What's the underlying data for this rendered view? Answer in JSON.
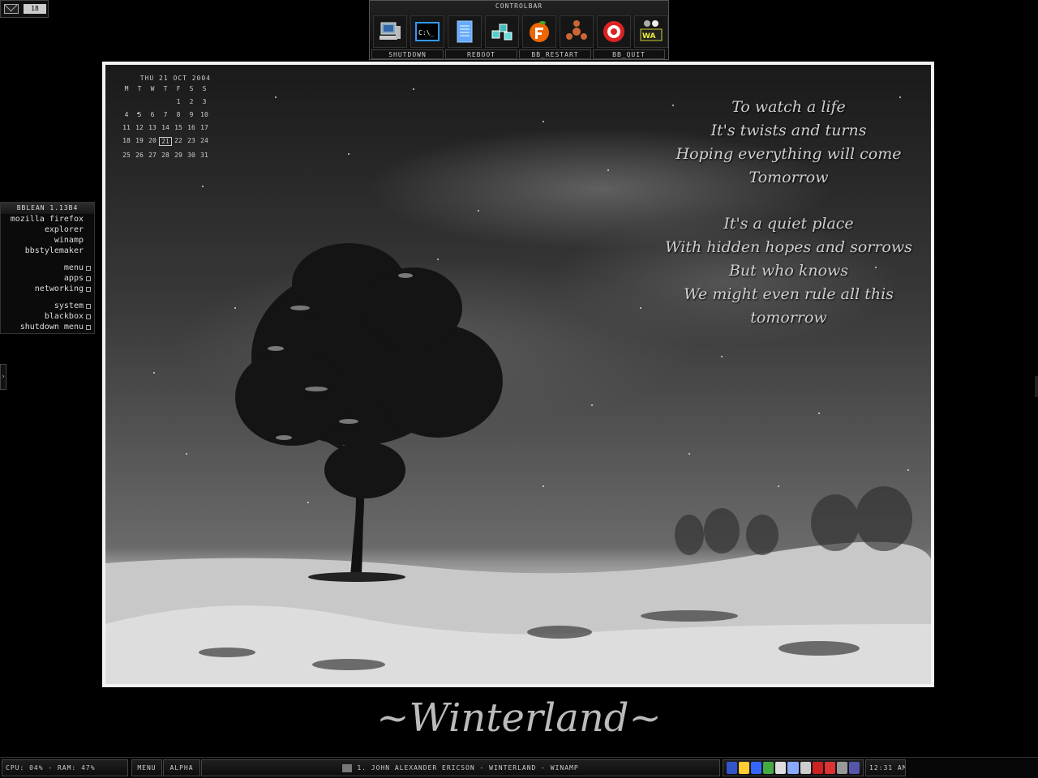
{
  "mail": {
    "count": "18"
  },
  "controlbar": {
    "title": "CONTROLBAR",
    "icons": [
      "my-computer-icon",
      "command-prompt-icon",
      "notepad-icon",
      "network-cube-icon",
      "fruity-loops-icon",
      "reason-icon",
      "media-player-icon",
      "winamp-icon"
    ],
    "buttons": [
      "SHUTDOWN",
      "REBOOT",
      "BB_RESTART",
      "BB_QUIT"
    ]
  },
  "calendar": {
    "header": "THU 21 OCT 2004",
    "weekdays": [
      "M",
      "T",
      "W",
      "T",
      "F",
      "S",
      "S"
    ],
    "weeks": [
      [
        "",
        "",
        "",
        "",
        "1",
        "2",
        "3"
      ],
      [
        "4",
        "5",
        "6",
        "7",
        "8",
        "9",
        "10"
      ],
      [
        "11",
        "12",
        "13",
        "14",
        "15",
        "16",
        "17"
      ],
      [
        "18",
        "19",
        "20",
        "21",
        "22",
        "23",
        "24"
      ],
      [
        "25",
        "26",
        "27",
        "28",
        "29",
        "30",
        "31"
      ]
    ],
    "today": "21"
  },
  "poem": [
    "To watch a life",
    "It's twists and turns",
    "Hoping everything will come",
    "Tomorrow",
    "",
    "It's a quiet place",
    "With hidden hopes and sorrows",
    "But who knows",
    "We might even rule all this tomorrow"
  ],
  "menu": {
    "title": "BBLEAN 1.13B4",
    "items": [
      "mozilla firefox",
      "explorer",
      "winamp",
      "bbstylemaker"
    ],
    "folders1": [
      "menu",
      "apps",
      "networking"
    ],
    "folders2": [
      "system",
      "blackbox",
      "shutdown menu"
    ]
  },
  "wallpaper_title": "~Winterland~",
  "taskbar": {
    "cpu": "CPU: 04% - RAM: 47%",
    "menu": "MENU",
    "alpha": "ALPHA",
    "task": "1. JOHN ALEXANDER ERICSON - WINTERLAND - WINAMP",
    "clock": "12:31 AM",
    "tray_colors": [
      "#3355cc",
      "#ffcc33",
      "#3366ff",
      "#44aa44",
      "#dddddd",
      "#88aaff",
      "#cccccc",
      "#cc2222",
      "#dd3333",
      "#999999",
      "#5555aa"
    ]
  }
}
